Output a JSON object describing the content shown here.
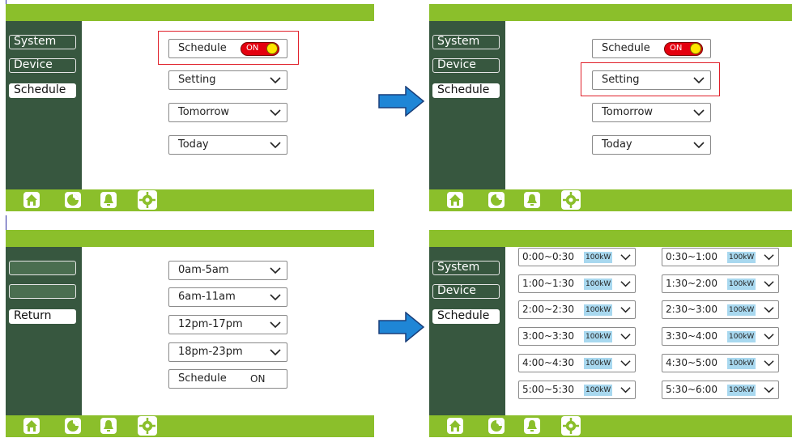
{
  "icons": [
    "home-icon",
    "chart-icon",
    "bell-icon",
    "gear-icon"
  ],
  "colors": {
    "bar_green": "#8bbf2b",
    "sidebar_green": "#37573f",
    "toggle_red": "#e4000f",
    "knob_yellow": "#ffe600",
    "power_blue": "#a8d8ef",
    "arrow_blue": "#1f86d6",
    "highlight_red": "#e0202a"
  },
  "menu": {
    "system": "System",
    "device": "Device",
    "schedule": "Schedule",
    "return": "Return"
  },
  "schedule_screen": {
    "schedule_label": "Schedule",
    "toggle_label": "ON",
    "options": [
      "Setting",
      "Tomorrow",
      "Today"
    ]
  },
  "periods_screen": {
    "periods": [
      "0am-5am",
      "6am-11am",
      "12pm-17pm",
      "18pm-23pm"
    ],
    "schedule_label": "Schedule",
    "schedule_value": "ON"
  },
  "timeslot_screen": {
    "power": "100kW",
    "slots": [
      "0:00~0:30",
      "0:30~1:00",
      "1:00~1:30",
      "1:30~2:00",
      "2:00~2:30",
      "2:30~3:00",
      "3:00~3:30",
      "3:30~4:00",
      "4:00~4:30",
      "4:30~5:00",
      "5:00~5:30",
      "5:30~6:00"
    ]
  }
}
